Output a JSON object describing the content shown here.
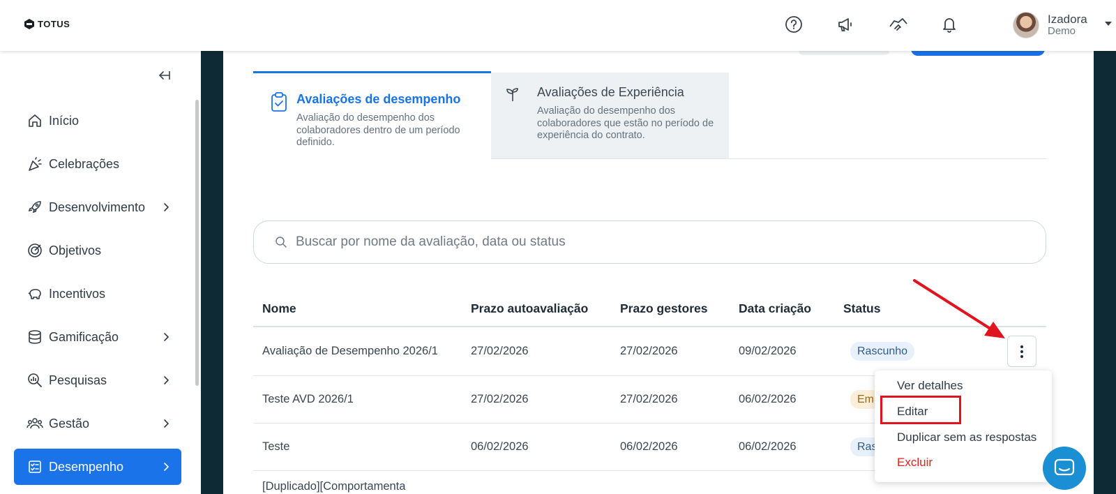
{
  "brand": {
    "logo_text": "TOTUS"
  },
  "header": {
    "user": {
      "name": "Izadora",
      "role": "Demo"
    }
  },
  "sidebar": {
    "items": [
      {
        "label": "Início",
        "icon": "home-icon",
        "has_children": false
      },
      {
        "label": "Celebrações",
        "icon": "party-icon",
        "has_children": false
      },
      {
        "label": "Desenvolvimento",
        "icon": "rocket-icon",
        "has_children": true
      },
      {
        "label": "Objetivos",
        "icon": "target-icon",
        "has_children": false
      },
      {
        "label": "Incentivos",
        "icon": "piggy-bank-icon",
        "has_children": false
      },
      {
        "label": "Gamificação",
        "icon": "coins-icon",
        "has_children": true
      },
      {
        "label": "Pesquisas",
        "icon": "search-chart-icon",
        "has_children": true
      },
      {
        "label": "Gestão",
        "icon": "team-icon",
        "has_children": true
      },
      {
        "label": "Desempenho",
        "icon": "checklist-icon",
        "has_children": true,
        "active": true
      }
    ]
  },
  "tabs": [
    {
      "title": "Avaliações de desempenho",
      "description": "Avaliação do desempenho dos colaboradores dentro de um período definido.",
      "active": true
    },
    {
      "title": "Avaliações de Experiência",
      "description": "Avaliação do desempenho dos colaboradores que estão no período de experiência do contrato.",
      "active": false
    }
  ],
  "search": {
    "placeholder": "Buscar por nome da avaliação, data ou status"
  },
  "table": {
    "columns": [
      "Nome",
      "Prazo autoavaliação",
      "Prazo gestores",
      "Data criação",
      "Status"
    ],
    "rows": [
      {
        "name": "Avaliação de Desempenho 2026/1",
        "self_deadline": "27/02/2026",
        "manager_deadline": "27/02/2026",
        "created": "09/02/2026",
        "status": "Rascunho"
      },
      {
        "name": "Teste AVD 2026/1",
        "self_deadline": "27/02/2026",
        "manager_deadline": "27/02/2026",
        "created": "06/02/2026",
        "status": "Em"
      },
      {
        "name": "Teste",
        "self_deadline": "06/02/2026",
        "manager_deadline": "06/02/2026",
        "created": "06/02/2026",
        "status": "Ras"
      },
      {
        "name": "[Duplicado][Comportamenta",
        "self_deadline": "",
        "manager_deadline": "",
        "created": "",
        "status": ""
      }
    ]
  },
  "row_menu": {
    "items": [
      "Ver detalhes",
      "Editar",
      "Duplicar sem as respostas",
      "Excluir"
    ]
  },
  "colors": {
    "accent": "#1a73e8",
    "danger": "#e0231c",
    "sidebar_dark": "#0e2a35",
    "annotation": "#e0141e"
  }
}
